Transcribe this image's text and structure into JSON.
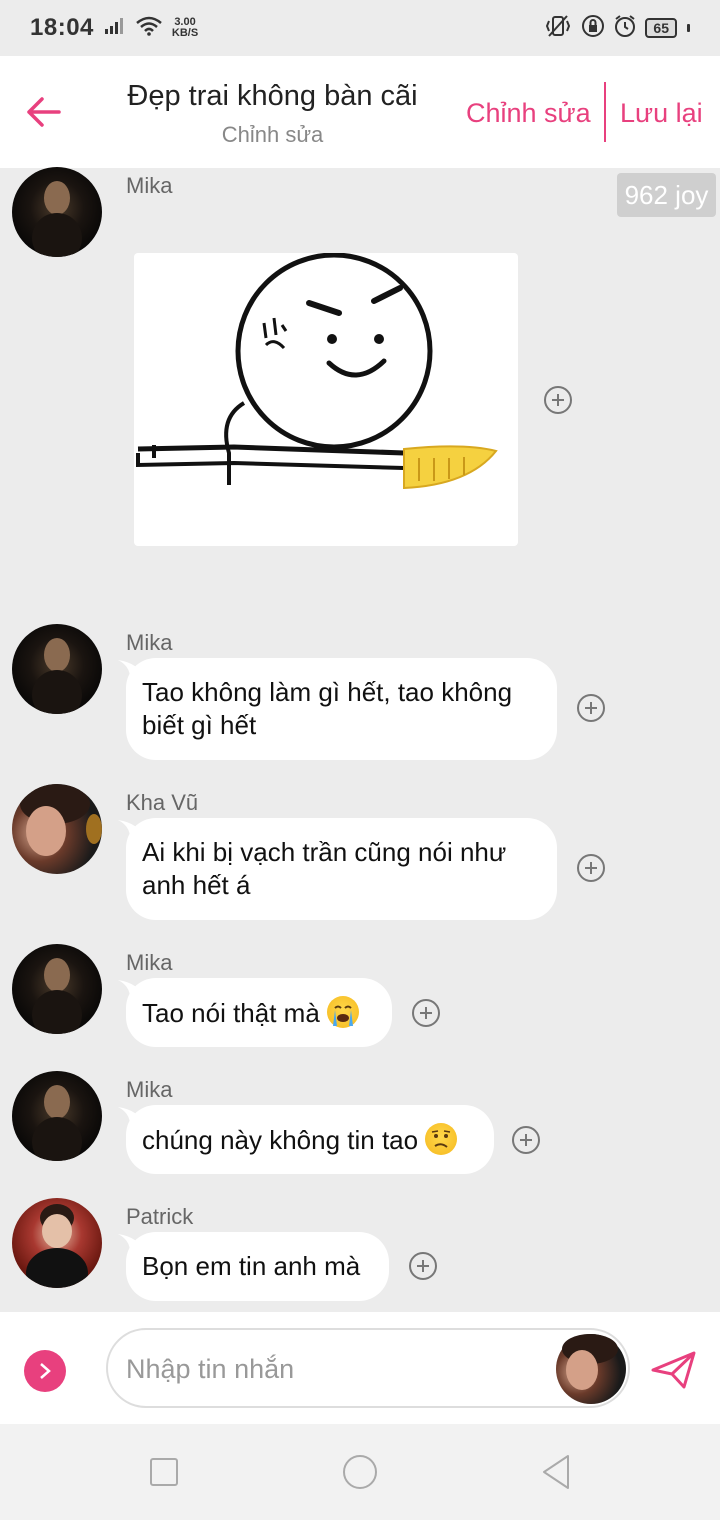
{
  "status_bar": {
    "time": "18:04",
    "net_speed_value": "3.00",
    "net_speed_unit": "KB/S",
    "battery": "65"
  },
  "header": {
    "title": "Đẹp trai không bàn cãi",
    "subtitle": "Chỉnh sửa",
    "edit_label": "Chỉnh sửa",
    "save_label": "Lưu lại"
  },
  "joy_badge": "962 joy",
  "messages": [
    {
      "sender": "Mika",
      "type": "sticker",
      "sticker": "stick-figure-with-knife"
    },
    {
      "sender": "Mika",
      "type": "text",
      "lines": [
        "Tao không làm gì hết, tao không",
        "biết gì hết"
      ]
    },
    {
      "sender": "Kha Vũ",
      "type": "text",
      "lines": [
        "Ai khi bị vạch trần cũng nói như",
        "anh hết á"
      ]
    },
    {
      "sender": "Mika",
      "type": "text",
      "text": "Tao nói thật mà",
      "emoji": "loudly-crying-face"
    },
    {
      "sender": "Mika",
      "type": "text",
      "text": "chúng này không tin tao",
      "emoji": "confused-face"
    },
    {
      "sender": "Patrick",
      "type": "text",
      "text": "Bọn em tin anh mà"
    }
  ],
  "input": {
    "placeholder": "Nhập tin nhắn"
  },
  "colors": {
    "accent": "#e8407e",
    "background": "#ececec",
    "bubble": "#ffffff"
  }
}
